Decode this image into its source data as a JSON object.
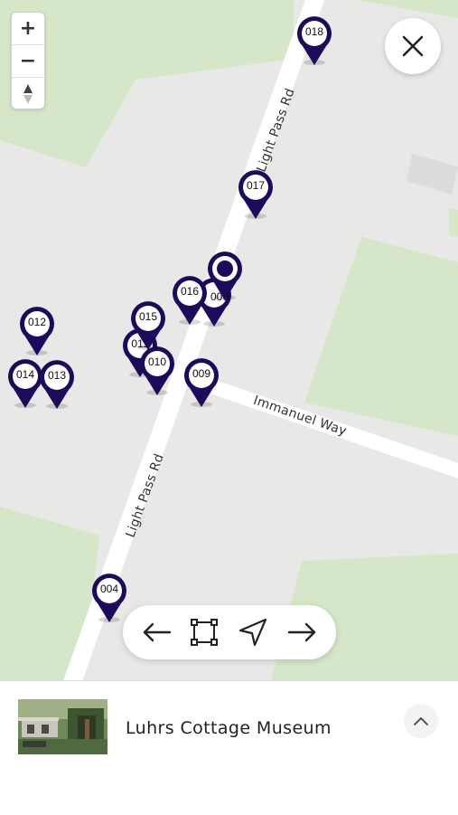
{
  "map": {
    "roads": {
      "light_pass_rd_north": "Light Pass Rd",
      "light_pass_rd_south": "Light Pass Rd",
      "immanuel_way": "Immanuel Way"
    },
    "markers": [
      {
        "id": "018"
      },
      {
        "id": "017"
      },
      {
        "id": "016"
      },
      {
        "id": "006"
      },
      {
        "id": "015"
      },
      {
        "id": "011"
      },
      {
        "id": "010"
      },
      {
        "id": "009"
      },
      {
        "id": "012"
      },
      {
        "id": "014"
      },
      {
        "id": "013"
      },
      {
        "id": "004"
      }
    ],
    "controls": {
      "zoom_in": "+",
      "zoom_out": "−"
    },
    "colors": {
      "marker": "#1e0a5c",
      "land": "#e8e8e6",
      "park": "#d6e6c8",
      "road": "#ffffff"
    }
  },
  "navigation": {
    "icons": [
      "arrow-left-icon",
      "frame-icon",
      "location-arrow-icon",
      "arrow-right-icon"
    ]
  },
  "bottom_sheet": {
    "title": "Luhrs Cottage Museum"
  }
}
